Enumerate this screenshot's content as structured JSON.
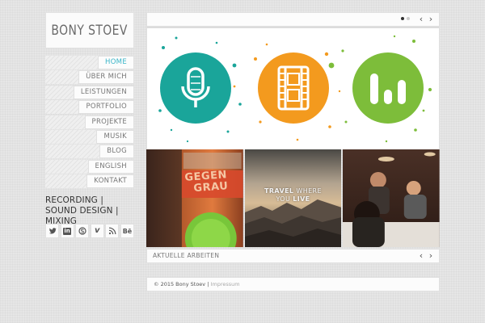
{
  "logo": {
    "text": "BONY STOEV"
  },
  "nav": {
    "items": [
      {
        "label": "HOME",
        "active": true
      },
      {
        "label": "ÜBER MICH",
        "active": false
      },
      {
        "label": "LEISTUNGEN",
        "active": false
      },
      {
        "label": "PORTFOLIO",
        "active": false
      },
      {
        "label": "PROJEKTE",
        "active": false
      },
      {
        "label": "MUSIK",
        "active": false
      },
      {
        "label": "BLOG",
        "active": false
      },
      {
        "label": "ENGLISH",
        "active": false
      },
      {
        "label": "KONTAKT",
        "active": false
      }
    ]
  },
  "tagline": {
    "line1": "RECORDING | SOUND DESIGN |",
    "line2": "MIXING"
  },
  "social": {
    "icons": [
      "twitter-icon",
      "linkedin-icon",
      "skype-icon",
      "vimeo-icon",
      "rss-icon",
      "behance-icon"
    ],
    "labels": {
      "linkedin": "in",
      "vimeo": "v",
      "behance": "Bē"
    }
  },
  "slider": {
    "prev": "‹",
    "next": "›",
    "dots": 2,
    "active_dot": 1,
    "circles": [
      {
        "icon": "microphone-icon",
        "color": "#1aa59a"
      },
      {
        "icon": "film-strip-icon",
        "color": "#f39a1e"
      },
      {
        "icon": "equalizer-icon",
        "color": "#7dbd3a"
      }
    ]
  },
  "thumbs": [
    {
      "name": "gegen-grau",
      "text_line1": "GEGEN",
      "text_line2": "GRAU"
    },
    {
      "name": "travel",
      "caption_line1_a": "TRAVEL",
      "caption_line1_b": " WHERE",
      "caption_line2_a": "YOU ",
      "caption_line2_b": "LIVE"
    },
    {
      "name": "dinner"
    }
  ],
  "recent": {
    "label": "AKTUELLE ARBEITEN",
    "prev": "‹",
    "next": "›"
  },
  "footer": {
    "text": "© 2015 Bony Stoev |",
    "link": "Impressum"
  },
  "colors": {
    "accent": "#3ab5c8",
    "teal": "#1aa59a",
    "orange": "#f39a1e",
    "green": "#7dbd3a"
  }
}
